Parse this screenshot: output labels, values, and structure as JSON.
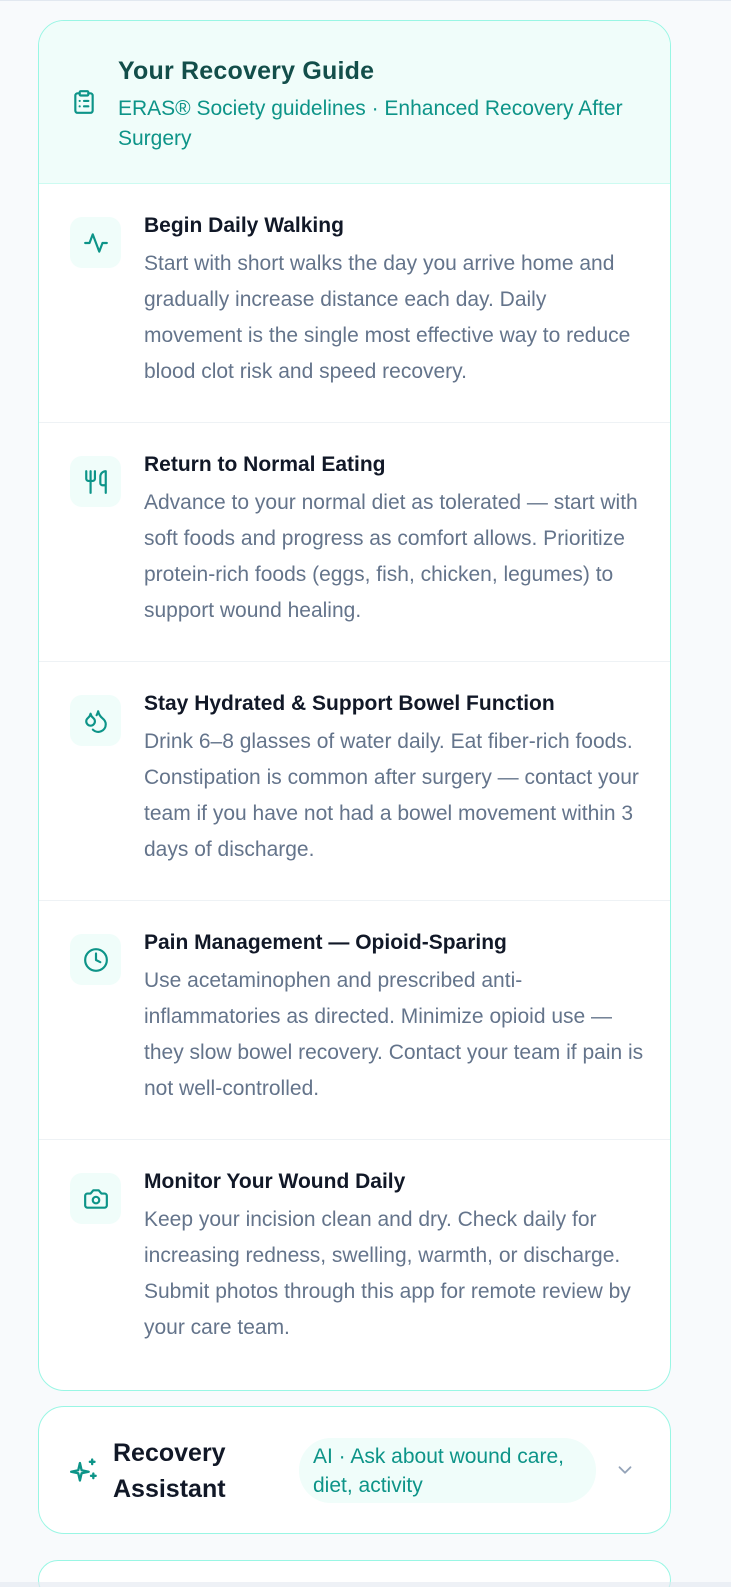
{
  "guide": {
    "title": "Your Recovery Guide",
    "subtitle": "ERAS® Society guidelines · Enhanced Recovery After Surgery",
    "header_icon": "clipboard-icon",
    "items": [
      {
        "icon": "activity-pulse-icon",
        "title": "Begin Daily Walking",
        "body": "Start with short walks the day you arrive home and gradually increase distance each day. Daily movement is the single most effective way to reduce blood clot risk and speed recovery."
      },
      {
        "icon": "utensils-icon",
        "title": "Return to Normal Eating",
        "body": "Advance to your normal diet as tolerated — start with soft foods and progress as comfort allows. Prioritize protein-rich foods (eggs, fish, chicken, legumes) to support wound healing."
      },
      {
        "icon": "droplets-icon",
        "title": "Stay Hydrated & Support Bowel Function",
        "body": "Drink 6–8 glasses of water daily. Eat fiber-rich foods. Constipation is common after surgery — contact your team if you have not had a bowel movement within 3 days of discharge."
      },
      {
        "icon": "clock-icon",
        "title": "Pain Management — Opioid-Sparing",
        "body": "Use acetaminophen and prescribed anti-inflammatories as directed. Minimize opioid use — they slow bowel recovery. Contact your team if pain is not well-controlled."
      },
      {
        "icon": "camera-icon",
        "title": "Monitor Your Wound Daily",
        "body": "Keep your incision clean and dry. Check daily for increasing redness, swelling, warmth, or discharge. Submit photos through this app for remote review by your care team."
      }
    ]
  },
  "assistant": {
    "icon": "sparkles-icon",
    "title": "Recovery Assistant",
    "badge": "AI · Ask about wound care, diet, activity",
    "chevron_icon": "chevron-down-icon"
  },
  "colors": {
    "accent": "#0d9488",
    "accent_dark": "#134e4a",
    "card_border": "#99f6e4",
    "header_bg": "#f0fdfa",
    "body_text": "#64748b",
    "title_text": "#111827"
  }
}
